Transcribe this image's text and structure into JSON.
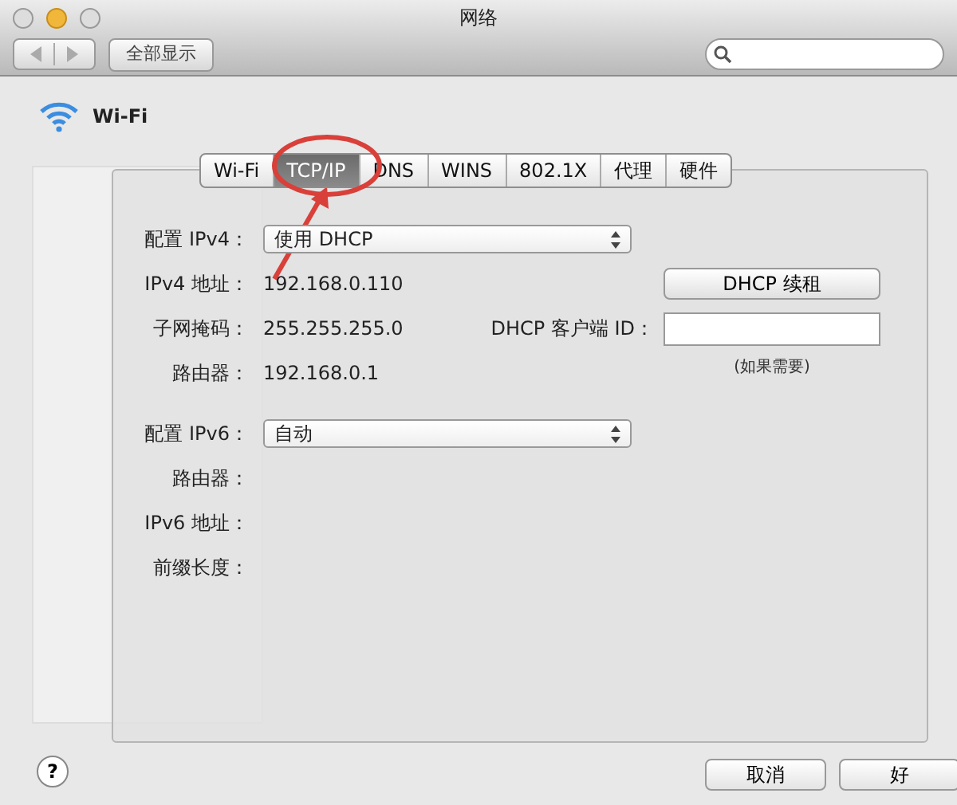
{
  "window": {
    "title": "网络",
    "show_all_button": "全部显示"
  },
  "interface": {
    "name": "Wi-Fi"
  },
  "sheet": {
    "tabs": [
      {
        "label": "Wi-Fi",
        "selected": false
      },
      {
        "label": "TCP/IP",
        "selected": true
      },
      {
        "label": "DNS",
        "selected": false
      },
      {
        "label": "WINS",
        "selected": false
      },
      {
        "label": "802.1X",
        "selected": false
      },
      {
        "label": "代理",
        "selected": false
      },
      {
        "label": "硬件",
        "selected": false
      }
    ],
    "ipv4": {
      "label": "配置 IPv4：",
      "value": "使用 DHCP"
    },
    "ipv4_fields": [
      {
        "label": "IPv4 地址：",
        "value": "192.168.0.110"
      },
      {
        "label": "子网掩码：",
        "value": "255.255.255.0"
      },
      {
        "label": "路由器：",
        "value": "192.168.0.1"
      }
    ],
    "renew_button": "DHCP 续租",
    "client_id": {
      "label": "DHCP 客户端 ID：",
      "note": "(如果需要)"
    },
    "ipv6": {
      "label": "配置 IPv6：",
      "value": "自动"
    },
    "ipv6_fields": [
      {
        "label": "路由器："
      },
      {
        "label": "IPv6 地址："
      },
      {
        "label": "前缀长度："
      }
    ],
    "cancel_button": "取消",
    "ok_button": "好"
  },
  "help_button": "?"
}
